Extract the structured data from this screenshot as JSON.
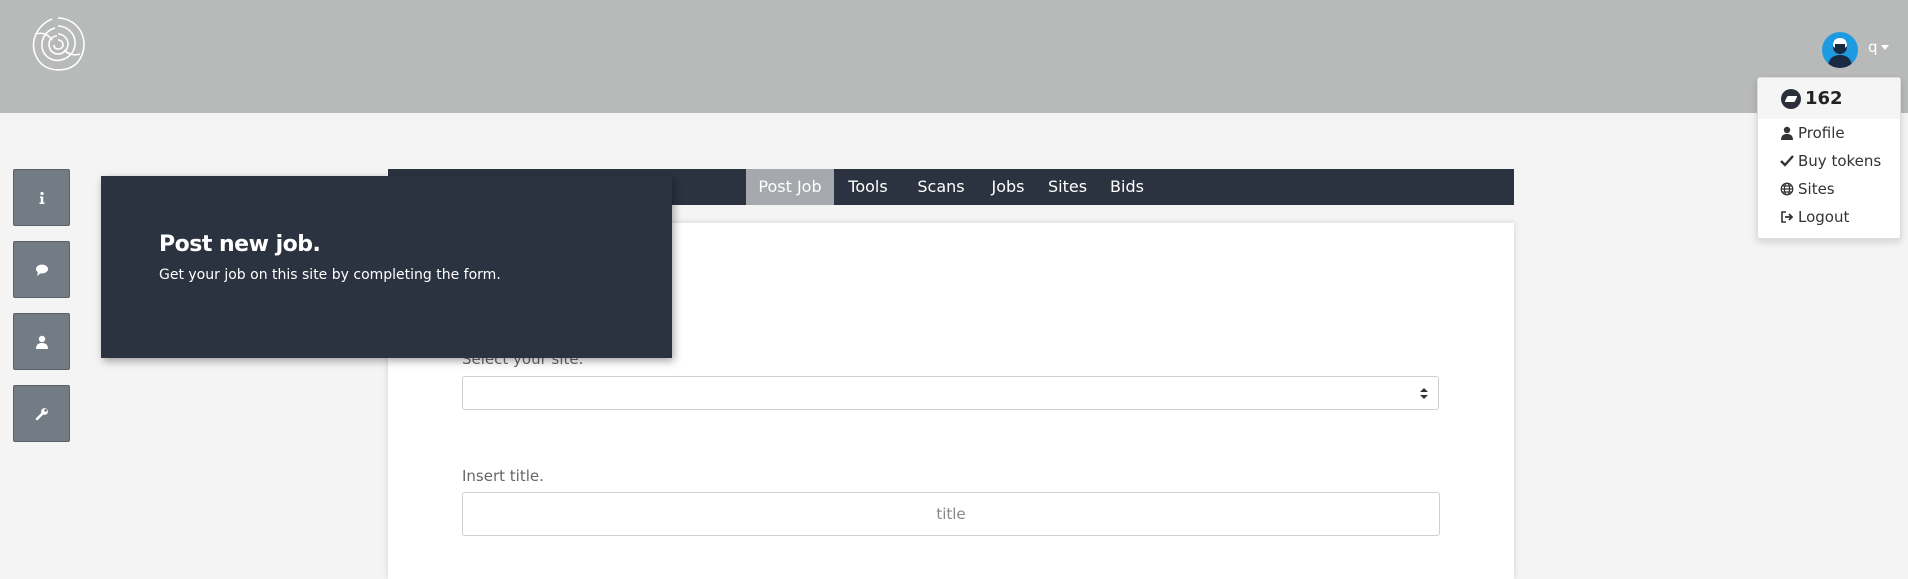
{
  "header": {
    "logo_icon": "rose-logo-icon",
    "username": "q",
    "avatar_icon": "user-avatar-icon",
    "bg_color": "#b8bab9",
    "accent_color": "#1e9be0"
  },
  "user_menu": {
    "tokens": "162",
    "token_icon": "token-icon",
    "items": [
      {
        "label": "Profile",
        "icon": "user-icon"
      },
      {
        "label": "Buy tokens",
        "icon": "check-icon"
      },
      {
        "label": "Sites",
        "icon": "globe-icon"
      },
      {
        "label": "Logout",
        "icon": "logout-icon"
      }
    ]
  },
  "sidebar": {
    "buttons": [
      {
        "icon": "info-icon"
      },
      {
        "icon": "comment-icon"
      },
      {
        "icon": "user-icon"
      },
      {
        "icon": "wrench-icon"
      }
    ]
  },
  "nav": {
    "items": [
      "Post Job",
      "Tools",
      "Scans",
      "Jobs",
      "Sites",
      "Bids"
    ],
    "active": "Post Job"
  },
  "tooltip": {
    "title": "Post new job.",
    "text": "Get your job on this site by completing the form."
  },
  "form": {
    "site_label": "Select your site.",
    "site_value": "",
    "title_label": "Insert title.",
    "title_placeholder": "title",
    "title_value": ""
  }
}
